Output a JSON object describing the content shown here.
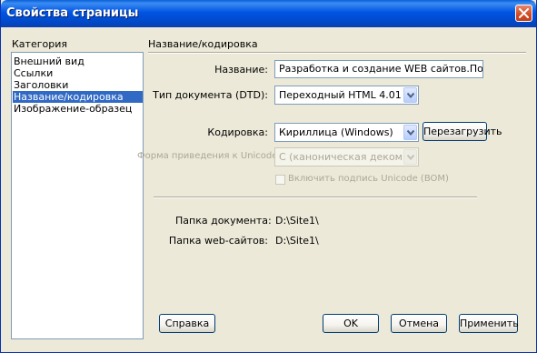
{
  "window": {
    "title": "Свойства страницы"
  },
  "category": {
    "heading": "Категория",
    "items": [
      "Внешний вид",
      "Ссылки",
      "Заголовки",
      "Название/кодировка",
      "Изображение-образец"
    ],
    "selected_index": 3
  },
  "panel": {
    "heading": "Название/кодировка",
    "title_label": "Название:",
    "title_value": "Разработка и создание WEB сайтов.Пошаговое об",
    "doctype_label": "Тип документа (DTD):",
    "doctype_value": "Переходный HTML 4.01",
    "encoding_label": "Кодировка:",
    "encoding_value": "Кириллица (Windows)",
    "reload_button": "Перезагрузить",
    "unicode_form_label": "Форма приведения к Unicode:",
    "unicode_form_value": "C (каноническая декомпозиция и",
    "bom_label": "Включить подпись Unicode (BOM)",
    "bom_checked": false,
    "doc_folder_label": "Папка документа:",
    "doc_folder_value": "D:\\Site1\\",
    "site_folder_label": "Папка web-сайтов:",
    "site_folder_value": "D:\\Site1\\"
  },
  "buttons": {
    "help": "Справка",
    "ok": "OK",
    "cancel": "Отмена",
    "apply": "Применить"
  },
  "icons": {
    "close": "close-icon",
    "dropdown": "chevron-down-icon"
  },
  "colors": {
    "title_bar": "#0054e3",
    "selection": "#316ac5",
    "close_button": "#cf4a26",
    "dialog_bg": "#ece9d8"
  }
}
